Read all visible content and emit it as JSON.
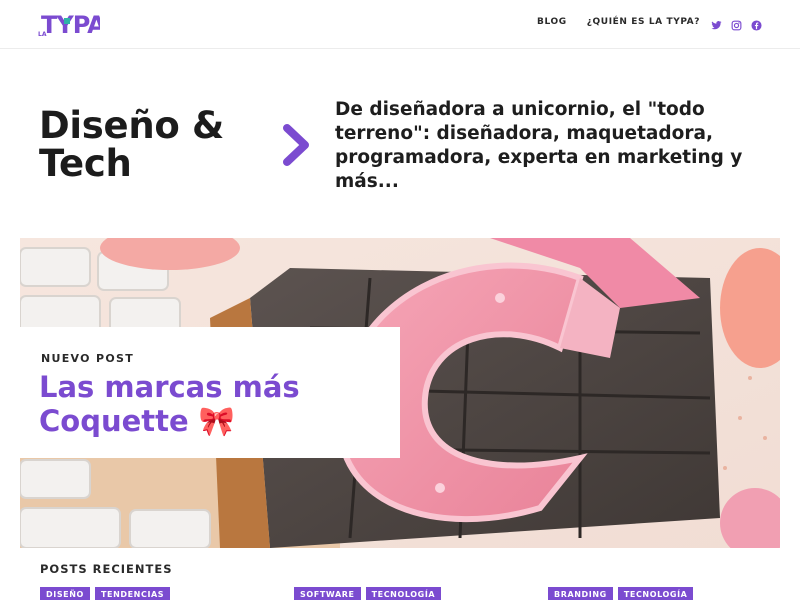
{
  "header": {
    "logo_text": "TYPA",
    "logo_small": "LA",
    "nav": [
      {
        "label": "BLOG"
      },
      {
        "label": "¿QUIÉN ES LA TYPA?"
      }
    ],
    "social_icons": [
      "twitter-icon",
      "instagram-icon",
      "facebook-icon"
    ]
  },
  "intro": {
    "title_line1": "Diseño &",
    "title_line2": "Tech",
    "description": "De diseñadora a unicornio, el \"todo terreno\": diseñadora, maquetadora, programadora, experta en marketing y más..."
  },
  "hero": {
    "kicker": "NUEVO POST",
    "title": "Las marcas más Coquette 🎀"
  },
  "recent": {
    "heading": "POSTS RECIENTES",
    "posts": [
      {
        "tags": [
          "DISEÑO",
          "TENDENCIAS"
        ]
      },
      {
        "tags": [
          "SOFTWARE",
          "TECNOLOGÍA"
        ]
      },
      {
        "tags": [
          "BRANDING",
          "TECNOLOGÍA"
        ]
      }
    ]
  },
  "colors": {
    "accent": "#7b4bd0",
    "text": "#1f1f1f",
    "logo_teal": "#2fb3a8"
  }
}
